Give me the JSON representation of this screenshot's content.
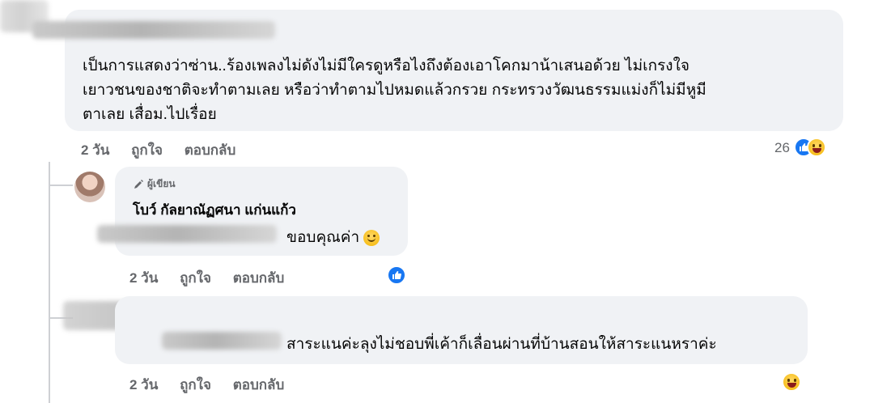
{
  "comment1": {
    "text_line1": "เป็นการแสดงว่าซ่าน..ร้องเพลงไม่ดังไม่มีใครดูหรือไงถึงต้องเอาโคกมาน้าเสนอด้วย ไม่เกรงใจ",
    "text_line2": "เยาวชนของชาติจะทำตามเลย หรือว่าทำตามไปหมดแล้วกรวย กระทรวงวัฒนธรรมแม่งก็ไม่มีหูมี",
    "text_line3": "ตาเลย เสื่อม.ไปเรื่อย",
    "time": "2 วัน",
    "like": "ถูกใจ",
    "reply": "ตอบกลับ",
    "reaction_count": "26",
    "reactions": [
      "like-icon",
      "haha-icon"
    ]
  },
  "reply1": {
    "author_badge": "ผู้เขียน",
    "author": "โบว์ กัลยาณัฏศนา แก่นแก้ว",
    "text": "ขอบคุณค่า",
    "time": "2 วัน",
    "like": "ถูกใจ",
    "reply": "ตอบกลับ",
    "reactions": [
      "like-icon"
    ]
  },
  "reply2": {
    "text": "สาระแนค่ะลุงไม่ชอบพี่เค้าก็เลื่อนผ่านที่บ้านสอนให้สาระแนหราค่ะ",
    "time": "2 วัน",
    "like": "ถูกใจ",
    "reply": "ตอบกลับ",
    "reactions": [
      "haha-icon"
    ]
  },
  "colors": {
    "bubble": "#f0f2f5",
    "meta": "#65676b",
    "like": "#1877f2"
  }
}
